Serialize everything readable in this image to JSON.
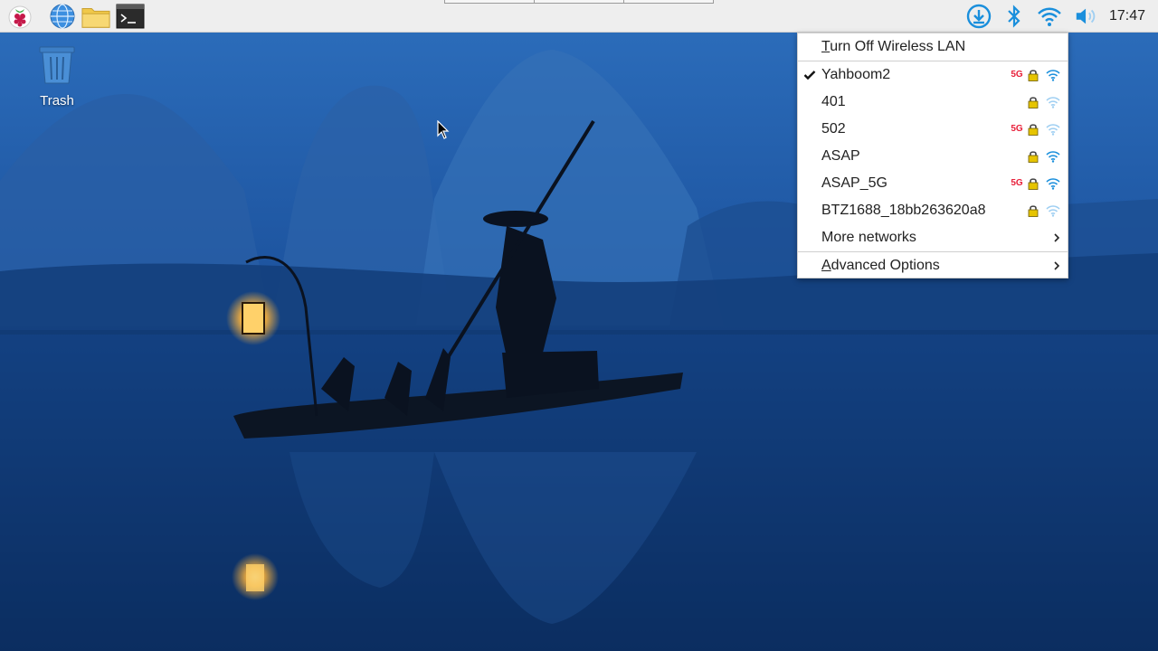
{
  "panel": {
    "clock": "17:47",
    "launchers": [
      "raspberry-menu-icon",
      "web-browser-icon",
      "file-manager-icon",
      "terminal-icon"
    ],
    "tray": [
      "download-icon",
      "bluetooth-icon",
      "wifi-icon",
      "volume-icon"
    ]
  },
  "desktop": {
    "trash_label": "Trash"
  },
  "network_menu": {
    "turn_off": {
      "accel": "T",
      "rest": "urn Off Wireless LAN"
    },
    "networks": [
      {
        "ssid": "Yahboom2",
        "connected": true,
        "is_5g": true,
        "secured": true,
        "signal": "strong"
      },
      {
        "ssid": "401",
        "connected": false,
        "is_5g": false,
        "secured": true,
        "signal": "weak"
      },
      {
        "ssid": "502",
        "connected": false,
        "is_5g": true,
        "secured": true,
        "signal": "weak"
      },
      {
        "ssid": "ASAP",
        "connected": false,
        "is_5g": false,
        "secured": true,
        "signal": "strong"
      },
      {
        "ssid": "ASAP_5G",
        "connected": false,
        "is_5g": true,
        "secured": true,
        "signal": "strong"
      },
      {
        "ssid": "BTZ1688_18bb263620a8",
        "connected": false,
        "is_5g": false,
        "secured": true,
        "signal": "weak"
      }
    ],
    "badge_5g": "5G",
    "more_networks": "More networks",
    "advanced": {
      "accel": "A",
      "rest": "dvanced Options"
    }
  },
  "colors": {
    "accent": "#1a8fdc",
    "badge_5g": "#e8203a",
    "lock": "#e6c400"
  }
}
